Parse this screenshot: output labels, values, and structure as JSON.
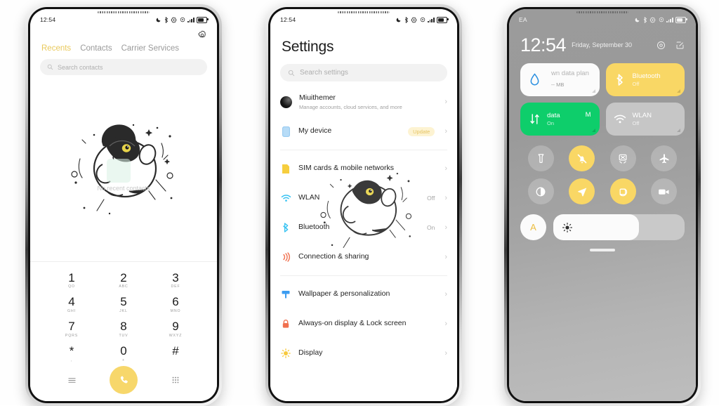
{
  "phone1": {
    "status": {
      "time": "12:54",
      "icons": [
        "dnd-moon-icon",
        "bluetooth-icon",
        "settings-star-icon",
        "alarm-icon",
        "signal-bars-icon",
        "battery-icon"
      ]
    },
    "gear_icon": "gear-icon",
    "tabs": [
      {
        "label": "Recents",
        "active": true
      },
      {
        "label": "Contacts",
        "active": false
      },
      {
        "label": "Carrier Services",
        "active": false
      }
    ],
    "search": {
      "placeholder": "Search contacts",
      "icon": "search-icon"
    },
    "empty_text": "No recent contacts",
    "keypad": [
      {
        "digit": "1",
        "letters": "QO"
      },
      {
        "digit": "2",
        "letters": "ABC"
      },
      {
        "digit": "3",
        "letters": "DEF"
      },
      {
        "digit": "4",
        "letters": "GHI"
      },
      {
        "digit": "5",
        "letters": "JKL"
      },
      {
        "digit": "6",
        "letters": "MNO"
      },
      {
        "digit": "7",
        "letters": "PQRS"
      },
      {
        "digit": "8",
        "letters": "TUV"
      },
      {
        "digit": "9",
        "letters": "WXYZ"
      },
      {
        "digit": "*",
        "letters": ","
      },
      {
        "digit": "0",
        "letters": "+"
      },
      {
        "digit": "#",
        "letters": ""
      }
    ],
    "bottom": {
      "menu_icon": "menu-lines-icon",
      "call_icon": "phone-handset-icon",
      "keypad_icon": "dialpad-icon"
    },
    "accent": "#f7d76b"
  },
  "phone2": {
    "status": {
      "time": "12:54"
    },
    "title": "Settings",
    "search": {
      "placeholder": "Search settings",
      "icon": "search-icon"
    },
    "account": {
      "name": "Miuithemer",
      "subtitle": "Manage accounts, cloud services, and more",
      "avatar": "user-avatar"
    },
    "items": [
      {
        "label": "My device",
        "icon": "device-icon",
        "badge": "Update",
        "value": ""
      },
      {
        "label": "SIM cards & mobile networks",
        "icon": "sim-card-icon",
        "badge": "",
        "value": ""
      },
      {
        "label": "WLAN",
        "icon": "wifi-icon",
        "badge": "",
        "value": "Off"
      },
      {
        "label": "Bluetooth",
        "icon": "bluetooth-icon",
        "badge": "",
        "value": "On"
      },
      {
        "label": "Connection & sharing",
        "icon": "connection-sharing-icon",
        "badge": "",
        "value": ""
      },
      {
        "label": "Wallpaper & personalization",
        "icon": "wallpaper-icon",
        "badge": "",
        "value": ""
      },
      {
        "label": "Always-on display & Lock screen",
        "icon": "lock-icon",
        "badge": "",
        "value": ""
      },
      {
        "label": "Display",
        "icon": "display-sun-icon",
        "badge": "",
        "value": ""
      }
    ]
  },
  "phone3": {
    "status": {
      "carrier": "EA"
    },
    "clock": {
      "time": "12:54",
      "date": "Friday, September 30"
    },
    "header_icons": [
      "settings-gear-icon",
      "edit-pencil-icon"
    ],
    "tiles": [
      {
        "title": "wn data plan",
        "sub": "-- MB",
        "icon": "data-drop-icon",
        "style": "white"
      },
      {
        "title": "Bluetooth",
        "sub": "Off",
        "icon": "bluetooth-icon",
        "style": "yellow"
      },
      {
        "title": "data",
        "sub": "On",
        "extra": "M",
        "icon": "mobile-data-icon",
        "style": "green"
      },
      {
        "title": "WLAN",
        "sub": "Off",
        "icon": "wifi-icon",
        "style": "grey"
      }
    ],
    "toggles": [
      {
        "icon": "flashlight-icon",
        "on": false
      },
      {
        "icon": "silent-mode-icon",
        "on": true
      },
      {
        "icon": "cast-screenshot-icon",
        "on": false
      },
      {
        "icon": "airplane-mode-icon",
        "on": false
      },
      {
        "icon": "dark-mode-icon",
        "on": false
      },
      {
        "icon": "location-icon",
        "on": true
      },
      {
        "icon": "auto-rotate-icon",
        "on": true
      },
      {
        "icon": "screen-recorder-icon",
        "on": false
      }
    ],
    "brightness": {
      "auto_label": "A",
      "icon": "brightness-sun-icon",
      "level": 65
    }
  }
}
